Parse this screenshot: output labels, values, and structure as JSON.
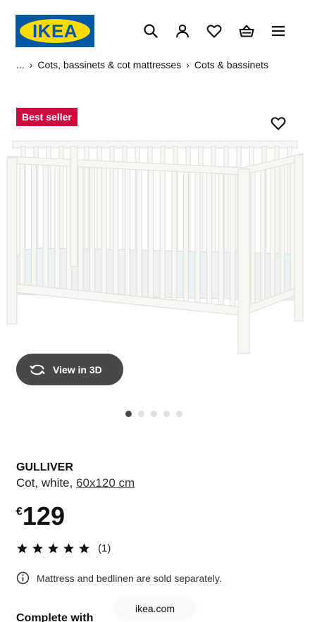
{
  "header": {
    "logo_text": "IKEA",
    "icons": [
      "search-icon",
      "account-icon",
      "heart-icon",
      "basket-icon",
      "menu-icon"
    ]
  },
  "breadcrumb": {
    "ellipsis": "...",
    "items": [
      "Cots, bassinets & cot mattresses",
      "Cots & bassinets"
    ]
  },
  "badge": "Best seller",
  "view3d_label": "View in 3D",
  "carousel": {
    "count": 5,
    "active": 1
  },
  "product": {
    "name": "GULLIVER",
    "description": "Cot, white, ",
    "size": "60x120 cm",
    "currency": "€",
    "price": "129",
    "rating": 5,
    "review_count": "(1)"
  },
  "info_note": "Mattress and bedlinen are sold separately.",
  "complete_with": "Complete with",
  "browser_url": "ikea.com",
  "colors": {
    "ikea_blue": "#0058a3",
    "ikea_yellow": "#ffdb00",
    "badge_red": "#cc0a3e",
    "dark_button": "#484848"
  }
}
